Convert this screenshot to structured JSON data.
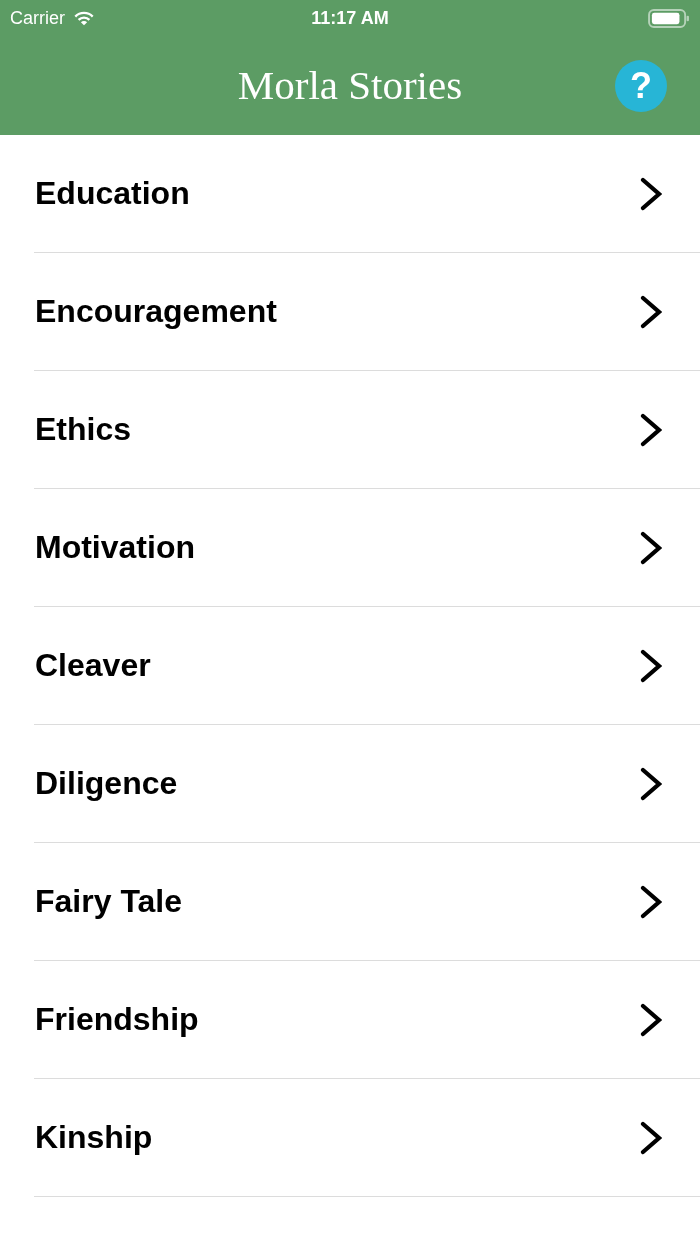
{
  "status_bar": {
    "carrier": "Carrier",
    "time": "11:17 AM"
  },
  "nav_bar": {
    "title": "Morla Stories",
    "help_button": "?"
  },
  "categories": [
    {
      "label": "Education"
    },
    {
      "label": "Encouragement"
    },
    {
      "label": "Ethics"
    },
    {
      "label": "Motivation"
    },
    {
      "label": "Cleaver"
    },
    {
      "label": "Diligence"
    },
    {
      "label": "Fairy Tale"
    },
    {
      "label": "Friendship"
    },
    {
      "label": "Kinship"
    }
  ]
}
